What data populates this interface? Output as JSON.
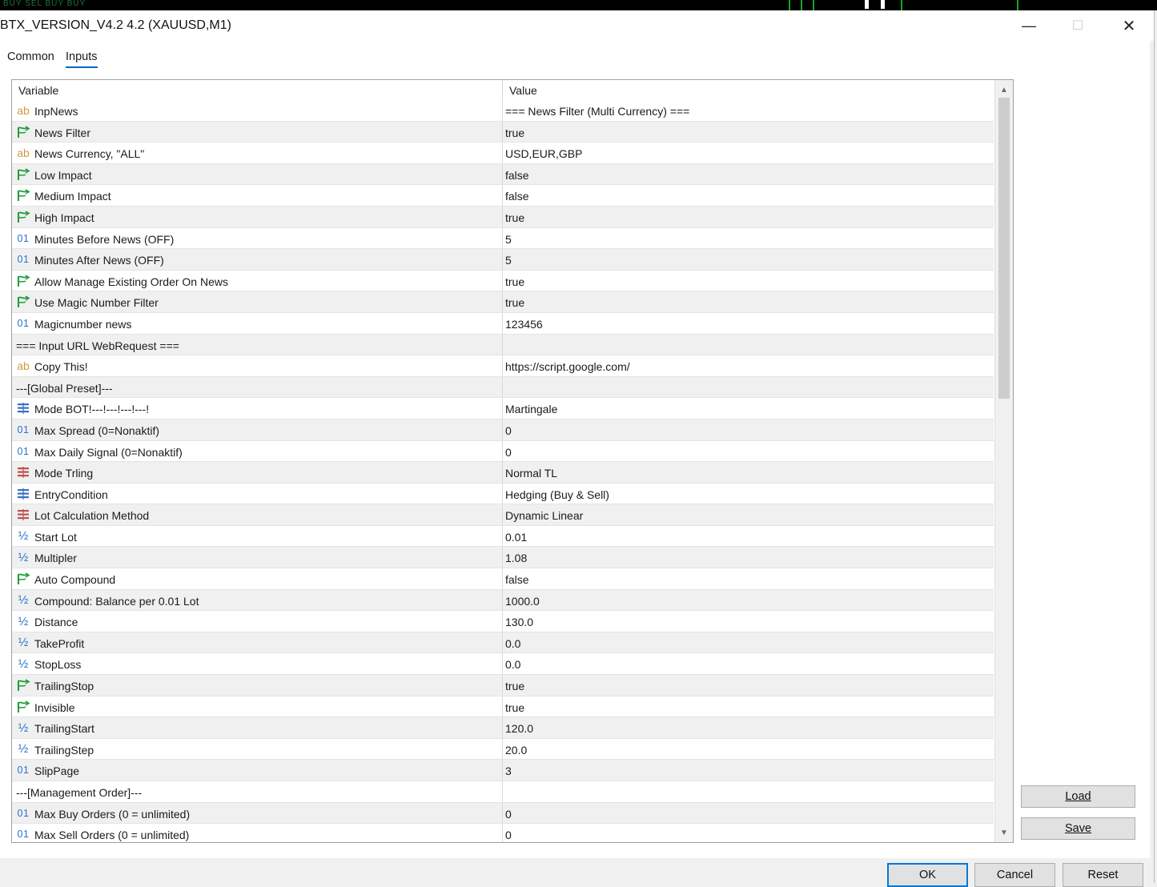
{
  "window": {
    "title": "BTX_VERSION_V4.2 4.2 (XAUUSD,M1)",
    "controls": {
      "minimize": "—",
      "maximize": "☐",
      "close": "✕"
    }
  },
  "background_strip": {
    "labels": "BUY SEL BUY BUY"
  },
  "tabs": [
    {
      "label": "Common",
      "active": false
    },
    {
      "label": "Inputs",
      "active": true
    }
  ],
  "grid": {
    "headers": {
      "variable": "Variable",
      "value": "Value"
    },
    "rows": [
      {
        "icon": "ab",
        "name": "InpNews",
        "value": "=== News Filter (Multi Currency) ==="
      },
      {
        "icon": "bool",
        "name": "News Filter",
        "value": "true"
      },
      {
        "icon": "ab",
        "name": "News Currency, \"ALL\"",
        "value": "USD,EUR,GBP"
      },
      {
        "icon": "bool",
        "name": "Low Impact",
        "value": "false"
      },
      {
        "icon": "bool",
        "name": "Medium Impact",
        "value": "false"
      },
      {
        "icon": "bool",
        "name": "High Impact",
        "value": "true"
      },
      {
        "icon": "01",
        "name": "Minutes Before News (OFF)",
        "value": "5"
      },
      {
        "icon": "01",
        "name": "Minutes After News (OFF)",
        "value": "5"
      },
      {
        "icon": "bool",
        "name": "Allow Manage Existing Order On News",
        "value": "true"
      },
      {
        "icon": "bool",
        "name": "Use Magic Number Filter",
        "value": "true"
      },
      {
        "icon": "01",
        "name": "Magicnumber news",
        "value": "123456"
      },
      {
        "icon": "",
        "name": "=== Input URL WebRequest ===",
        "value": ""
      },
      {
        "icon": "ab",
        "name": "Copy This!",
        "value": "https://script.google.com/"
      },
      {
        "icon": "",
        "name": "---[Global Preset]---",
        "value": ""
      },
      {
        "icon": "enum",
        "name": "Mode BOT!---!---!---!---!",
        "value": "Martingale"
      },
      {
        "icon": "01",
        "name": "Max Spread (0=Nonaktif)",
        "value": "0"
      },
      {
        "icon": "01",
        "name": "Max Daily Signal (0=Nonaktif)",
        "value": "0"
      },
      {
        "icon": "enum2",
        "name": "Mode Trling",
        "value": "Normal TL"
      },
      {
        "icon": "enum",
        "name": "EntryCondition",
        "value": "Hedging (Buy & Sell)"
      },
      {
        "icon": "enum2",
        "name": "Lot Calculation Method",
        "value": "Dynamic Linear"
      },
      {
        "icon": "half",
        "name": "Start Lot",
        "value": "0.01"
      },
      {
        "icon": "half",
        "name": "Multipler",
        "value": "1.08"
      },
      {
        "icon": "bool",
        "name": "Auto Compound",
        "value": "false"
      },
      {
        "icon": "half",
        "name": "Compound: Balance per 0.01 Lot",
        "value": "1000.0"
      },
      {
        "icon": "half",
        "name": "Distance",
        "value": "130.0"
      },
      {
        "icon": "half",
        "name": "TakeProfit",
        "value": "0.0"
      },
      {
        "icon": "half",
        "name": "StopLoss",
        "value": "0.0"
      },
      {
        "icon": "bool",
        "name": "TrailingStop",
        "value": "true"
      },
      {
        "icon": "bool",
        "name": "Invisible",
        "value": "true"
      },
      {
        "icon": "half",
        "name": "TrailingStart",
        "value": "120.0"
      },
      {
        "icon": "half",
        "name": "TrailingStep",
        "value": "20.0"
      },
      {
        "icon": "01",
        "name": "SlipPage",
        "value": "3"
      },
      {
        "icon": "",
        "name": "---[Management Order]---",
        "value": ""
      },
      {
        "icon": "01",
        "name": "Max Buy Orders (0 = unlimited)",
        "value": "0"
      },
      {
        "icon": "01",
        "name": "Max Sell Orders (0 = unlimited)",
        "value": "0"
      }
    ]
  },
  "icon_glyphs": {
    "ab": "ab",
    "01": "01",
    "half": "½"
  },
  "buttons": {
    "load": "Load",
    "save": "Save",
    "ok": "OK",
    "cancel": "Cancel",
    "reset": "Reset"
  },
  "colors": {
    "accent": "#0078d7",
    "bool_icon": "#1f9d3a",
    "int_icon": "#2874c9",
    "string_icon": "#d09a43",
    "enum_icon": "#3a6fc4",
    "enum2_icon": "#c0504d",
    "row_alt": "#f0f0f0"
  }
}
